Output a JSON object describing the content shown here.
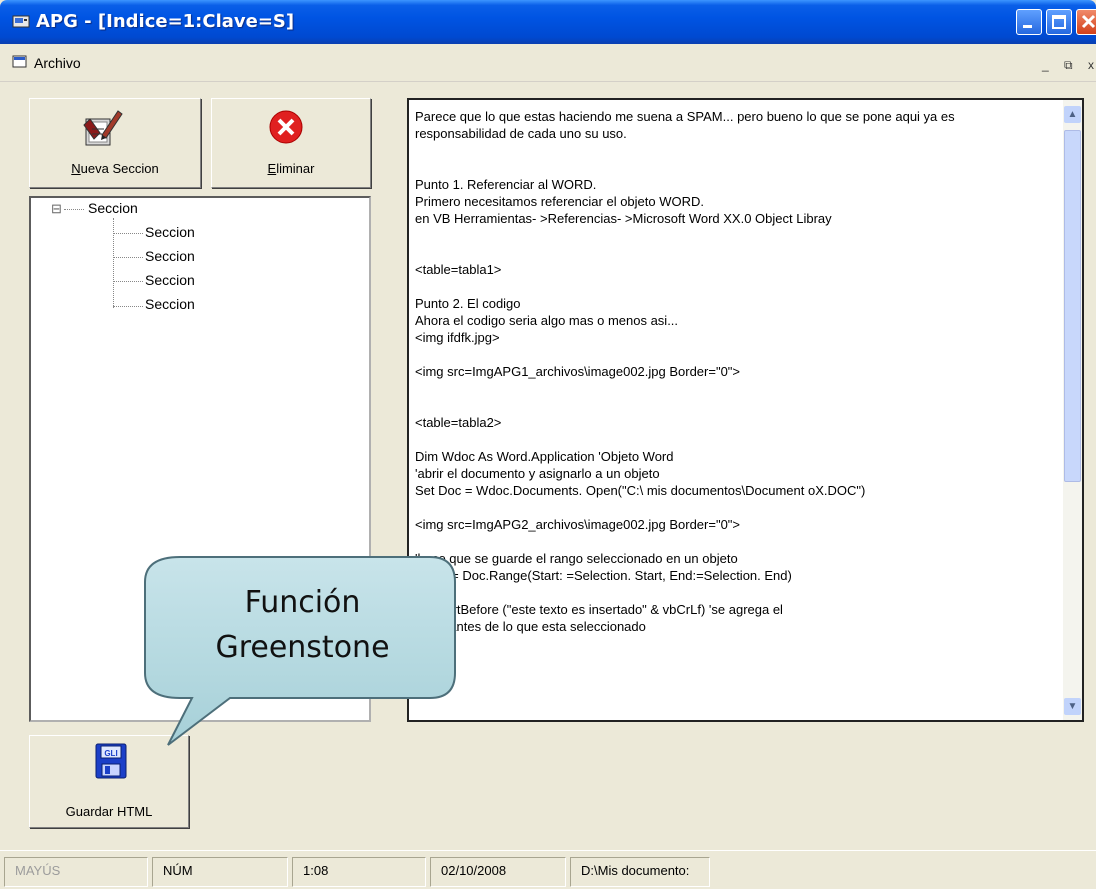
{
  "window": {
    "title": "APG - [Indice=1:Clave=S]",
    "minimize_icon": "minimize-icon",
    "maximize_icon": "maximize-icon",
    "close_icon": "close-icon"
  },
  "menubar": {
    "archivo": "Archivo",
    "mdi_min": "_",
    "mdi_restore": "⧉",
    "mdi_close": "x"
  },
  "toolbar": {
    "nueva_seccion_prefix": "N",
    "nueva_seccion_rest": "ueva Seccion",
    "eliminar_prefix": "E",
    "eliminar_rest": "liminar",
    "guardar_html": "Guardar HTML",
    "gli_label": "GLI"
  },
  "tree": {
    "root": "Seccion",
    "collapse_glyph": "⊟",
    "children": [
      "Seccion",
      "Seccion",
      "Seccion",
      "Seccion"
    ]
  },
  "editor": {
    "lines": [
      "Parece que lo que estas haciendo me suena a SPAM... pero bueno lo que se pone aqui ya es",
      "responsabilidad de cada uno su uso.",
      "",
      "",
      "Punto 1. Referenciar al WORD.",
      "Primero necesitamos referenciar el objeto WORD.",
      "en VB Herramientas- >Referencias- >Microsoft Word XX.0 Object Libray",
      "",
      "",
      "<table=tabla1>",
      "",
      "Punto 2. El codigo",
      "Ahora el codigo seria algo mas o menos asi...",
      "<img ifdfk.jpg>",
      "",
      "<img src=ImgAPG1_archivos\\image002.jpg Border=\"0\">",
      "",
      "",
      "<table=tabla2>",
      "",
      "Dim Wdoc As Word.Application 'Objeto Word",
      "'abrir el documento y asignarlo a un objeto",
      "Set Doc = Wdoc.Documents. Open(\"C:\\ mis documentos\\Document oX.DOC\")",
      "",
      "<img src=ImgAPG2_archivos\\image002.jpg Border=\"0\">",
      "",
      "'hace que se guarde el rango seleccionado en un objeto",
      "Set R = Doc.Range(Start: =Selection. Start, End:=Selection. End)",
      "",
      "R.InsertBefore (\"este texto es insertado\" & vbCrLf) 'se agrega el",
      "'texto antes de lo que esta seleccionado"
    ]
  },
  "callout": {
    "line1": "Función",
    "line2": "Greenstone"
  },
  "statusbar": {
    "mayus": "MAYÚS",
    "num": "NÚM",
    "position": "1:08",
    "date": "02/10/2008",
    "path": "D:\\Mis documento:"
  }
}
